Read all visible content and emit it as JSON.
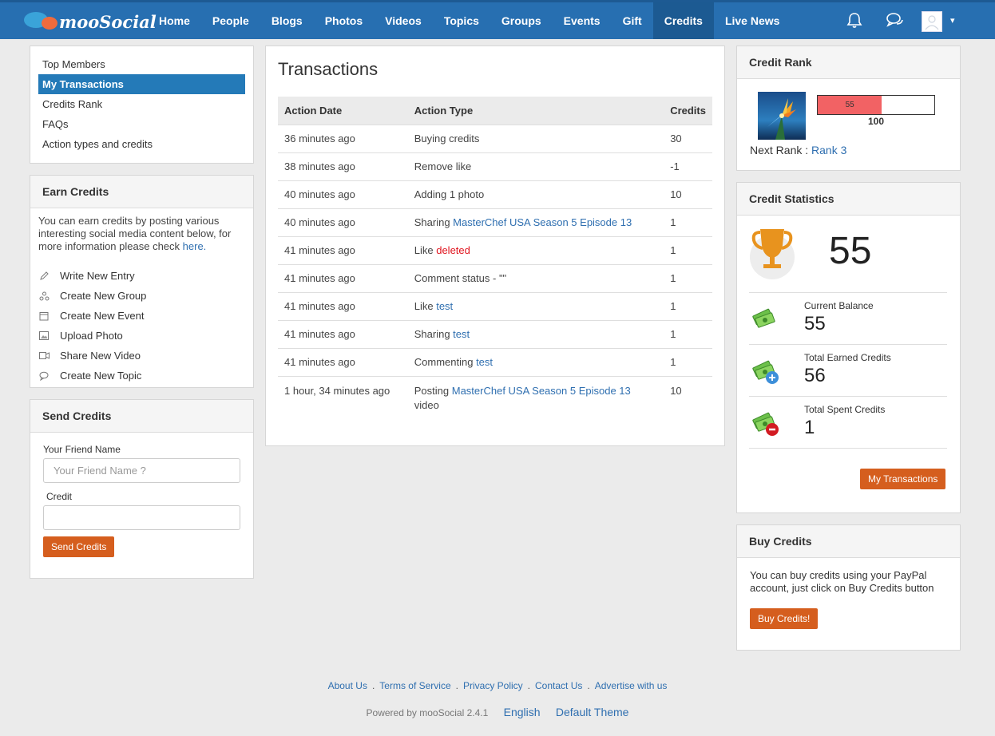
{
  "brand": {
    "name": "mooSocial"
  },
  "nav": {
    "items": [
      "Home",
      "People",
      "Blogs",
      "Photos",
      "Videos",
      "Topics",
      "Groups",
      "Events",
      "Gift",
      "Credits",
      "Live News"
    ],
    "active": "Credits"
  },
  "top_icons": [
    "bell-icon",
    "chat-icon",
    "user-avatar",
    "caret-down-icon"
  ],
  "sidebar": {
    "menu": [
      {
        "label": "Top Members",
        "active": false
      },
      {
        "label": "My Transactions",
        "active": true
      },
      {
        "label": "Credits Rank",
        "active": false
      },
      {
        "label": "FAQs",
        "active": false
      },
      {
        "label": "Action types and credits",
        "active": false
      }
    ]
  },
  "earn": {
    "title": "Earn Credits",
    "intro": "You can earn credits by posting various interesting social media content below, for more information please check",
    "intro_link": "here.",
    "items": [
      {
        "label": "Write New Entry",
        "icon": "pencil-icon"
      },
      {
        "label": "Create New Group",
        "icon": "group-icon"
      },
      {
        "label": "Create New Event",
        "icon": "calendar-icon"
      },
      {
        "label": "Upload Photo",
        "icon": "photo-icon"
      },
      {
        "label": "Share New Video",
        "icon": "video-icon"
      },
      {
        "label": "Create New Topic",
        "icon": "comment-icon"
      }
    ]
  },
  "send": {
    "title": "Send Credits",
    "friend_label": "Your Friend Name",
    "friend_placeholder": "Your Friend Name ?",
    "credit_label": "Credit",
    "credit_value": "",
    "button": "Send Credits"
  },
  "transactions": {
    "title": "Transactions",
    "headers": [
      "Action Date",
      "Action Type",
      "Credits"
    ],
    "rows": [
      {
        "date": "36 minutes ago",
        "type": "Buying credits",
        "link": "",
        "link_color": "",
        "credits": "30"
      },
      {
        "date": "38 minutes ago",
        "type": "Remove like",
        "link": "",
        "link_color": "",
        "credits": "-1"
      },
      {
        "date": "40 minutes ago",
        "type": "Adding 1 photo",
        "link": "",
        "link_color": "",
        "credits": "10"
      },
      {
        "date": "40 minutes ago",
        "type": "Sharing ",
        "link": "MasterChef USA Season 5 Episode 13",
        "link_color": "blue",
        "credits": "1"
      },
      {
        "date": "41 minutes ago",
        "type": "Like ",
        "link": "deleted",
        "link_color": "red",
        "credits": "1"
      },
      {
        "date": "41 minutes ago",
        "type": "Comment status - \"\"",
        "link": "",
        "link_color": "",
        "credits": "1"
      },
      {
        "date": "41 minutes ago",
        "type": "Like ",
        "link": "test",
        "link_color": "blue",
        "credits": "1"
      },
      {
        "date": "41 minutes ago",
        "type": "Sharing ",
        "link": "test",
        "link_color": "blue",
        "credits": "1"
      },
      {
        "date": "41 minutes ago",
        "type": "Commenting ",
        "link": "test",
        "link_color": "blue",
        "credits": "1"
      },
      {
        "date": "1 hour, 34 minutes ago",
        "type": "Posting ",
        "link": "MasterChef USA Season 5 Episode 13",
        "suffix": "video",
        "link_color": "blue",
        "credits": "10"
      }
    ]
  },
  "rank": {
    "title": "Credit Rank",
    "current": "55",
    "max": "100",
    "progress_fraction": 0.55,
    "next_label": "Next Rank :",
    "next_rank": "Rank 3"
  },
  "stats": {
    "title": "Credit Statistics",
    "total": "55",
    "rows": [
      {
        "label": "Current Balance",
        "value": "55",
        "badge": ""
      },
      {
        "label": "Total Earned Credits",
        "value": "56",
        "badge": "plus"
      },
      {
        "label": "Total Spent Credits",
        "value": "1",
        "badge": "minus"
      }
    ],
    "button": "My Transactions"
  },
  "buy": {
    "title": "Buy Credits",
    "text": "You can buy credits using your PayPal account, just click on Buy Credits button",
    "button": "Buy Credits!"
  },
  "footer": {
    "links": [
      "About Us",
      "Terms of Service",
      "Privacy Policy",
      "Contact Us",
      "Advertise with us"
    ],
    "separator": ".",
    "powered": "Powered by mooSocial 2.4.1",
    "language": "English",
    "theme": "Default Theme"
  },
  "colors": {
    "nav_bg": "#276fb1",
    "accent_orange": "#d55e1e",
    "menu_active": "#247ab8",
    "rank_fill": "#f26264",
    "link": "#2f6fb0"
  }
}
